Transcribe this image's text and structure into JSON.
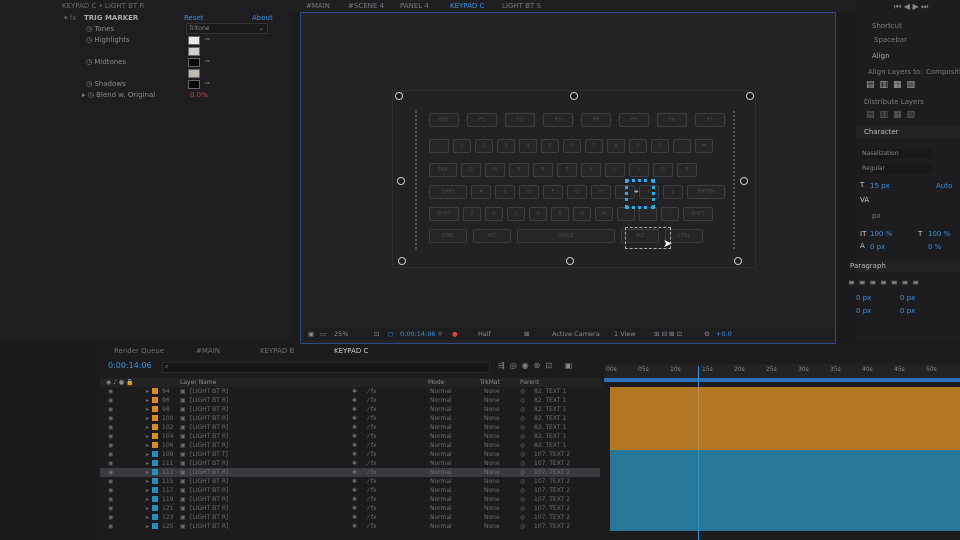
{
  "effect_panel": {
    "title": "KEYPAD C • LIGHT BT R",
    "effect_name": "TRIG MARKER",
    "reset": "Reset",
    "about": "About",
    "tones_label": "Tones",
    "tones_value": "Tritone",
    "highlights_label": "Highlights",
    "midtones_label": "Midtones",
    "shadows_label": "Shadows",
    "blend_label": "Blend w. Original",
    "blend_value": "0.0%"
  },
  "viewer": {
    "tabs": [
      "#MAIN",
      "#SCENE 4",
      "PANEL 4",
      "KEYPAD C",
      "LIGHT BT S"
    ],
    "active_tab": "KEYPAD C",
    "zoom": "25%",
    "timecode": "0:00:14:06",
    "resolution": "Half",
    "camera": "Active Camera",
    "view": "1 View",
    "exposure": "+0.0",
    "keys_row1": [
      "ESC",
      "F1",
      "F2",
      "F3",
      "F4",
      "F5",
      "F6",
      "F7"
    ],
    "keys_row2": [
      "`",
      "1",
      "2",
      "3",
      "4",
      "5",
      "6",
      "7",
      "8",
      "9",
      "0",
      "-",
      "="
    ],
    "keys_row3": [
      "TAB",
      "Q",
      "W",
      "E",
      "R",
      "T",
      "Y",
      "U",
      "I",
      "O",
      "P"
    ],
    "keys_row4": [
      "CAPS",
      "A",
      "S",
      "D",
      "F",
      "G",
      "H",
      "J",
      "K",
      "L",
      "ENTER"
    ],
    "keys_row5": [
      "SHIFT",
      "Z",
      "X",
      "C",
      "V",
      "B",
      "N",
      "M",
      ",",
      ".",
      "/",
      "SHIFT"
    ],
    "keys_row6": [
      "CTRL",
      "ALT",
      "SPACE",
      "ALT",
      "CTRL"
    ]
  },
  "right_panels": {
    "align": "Align",
    "align_layers_to": "Align Layers to:",
    "composition": "Composition",
    "distribute_layers": "Distribute Layers",
    "character": "Character",
    "font": "Nasalization",
    "style": "Regular",
    "font_size": "15 px",
    "leading": "Auto",
    "tracking_unit": "px",
    "vscale": "100 %",
    "hscale": "100 %",
    "baseline": "0 px",
    "tsume": "0 %",
    "paragraph": "Paragraph",
    "indent": "0 px",
    "top_labels": [
      "Shortcut",
      "Spacebar"
    ]
  },
  "timeline": {
    "tabs": [
      "Render Queue",
      "#MAIN",
      "KEYPAD B",
      "KEYPAD C"
    ],
    "active_tab": "KEYPAD C",
    "timecode": "0:00:14:06",
    "search_placeholder": "",
    "col_layer": "Layer Name",
    "col_mode": "Mode",
    "col_trkmat": "TrkMat",
    "col_parent": "Parent",
    "ruler": [
      "00s",
      "05s",
      "10s",
      "15s",
      "20s",
      "25s",
      "30s",
      "35s",
      "40s",
      "45s",
      "50s"
    ],
    "layers": [
      {
        "num": "94",
        "name": "[LIGHT BT R]",
        "mode": "Normal",
        "trk": "None",
        "parent": "82. TEXT 1",
        "color": "#d98d24"
      },
      {
        "num": "96",
        "name": "[LIGHT BT R]",
        "mode": "Normal",
        "trk": "None",
        "parent": "82. TEXT 1",
        "color": "#d98d24"
      },
      {
        "num": "98",
        "name": "[LIGHT BT R]",
        "mode": "Normal",
        "trk": "None",
        "parent": "82. TEXT 1",
        "color": "#d98d24"
      },
      {
        "num": "100",
        "name": "[LIGHT BT R]",
        "mode": "Normal",
        "trk": "None",
        "parent": "82. TEXT 1",
        "color": "#d98d24"
      },
      {
        "num": "102",
        "name": "[LIGHT BT R]",
        "mode": "Normal",
        "trk": "None",
        "parent": "82. TEXT 1",
        "color": "#d98d24"
      },
      {
        "num": "104",
        "name": "[LIGHT BT R]",
        "mode": "Normal",
        "trk": "None",
        "parent": "82. TEXT 1",
        "color": "#d98d24"
      },
      {
        "num": "106",
        "name": "[LIGHT BT R]",
        "mode": "Normal",
        "trk": "None",
        "parent": "82. TEXT 1",
        "color": "#d98d24"
      },
      {
        "num": "109",
        "name": "[LIGHT BT T]",
        "mode": "Normal",
        "trk": "None",
        "parent": "107. TEXT 2",
        "color": "#2a8fb8"
      },
      {
        "num": "111",
        "name": "[LIGHT BT R]",
        "mode": "Normal",
        "trk": "None",
        "parent": "107. TEXT 2",
        "color": "#2a8fb8"
      },
      {
        "num": "113",
        "name": "[LIGHT BT R]",
        "mode": "Normal",
        "trk": "None",
        "parent": "107. TEXT 2",
        "color": "#2a8fb8"
      },
      {
        "num": "115",
        "name": "[LIGHT BT R]",
        "mode": "Normal",
        "trk": "None",
        "parent": "107. TEXT 2",
        "color": "#2a8fb8"
      },
      {
        "num": "117",
        "name": "[LIGHT BT R]",
        "mode": "Normal",
        "trk": "None",
        "parent": "107. TEXT 2",
        "color": "#2a8fb8"
      },
      {
        "num": "119",
        "name": "[LIGHT BT R]",
        "mode": "Normal",
        "trk": "None",
        "parent": "107. TEXT 2",
        "color": "#2a8fb8"
      },
      {
        "num": "121",
        "name": "[LIGHT BT R]",
        "mode": "Normal",
        "trk": "None",
        "parent": "107. TEXT 2",
        "color": "#2a8fb8"
      },
      {
        "num": "123",
        "name": "[LIGHT BT R]",
        "mode": "Normal",
        "trk": "None",
        "parent": "107. TEXT 2",
        "color": "#2a8fb8"
      },
      {
        "num": "125",
        "name": "[LIGHT BT R]",
        "mode": "Normal",
        "trk": "None",
        "parent": "107. TEXT 2",
        "color": "#2a8fb8"
      }
    ],
    "accent_color": "#3b8fe0"
  }
}
